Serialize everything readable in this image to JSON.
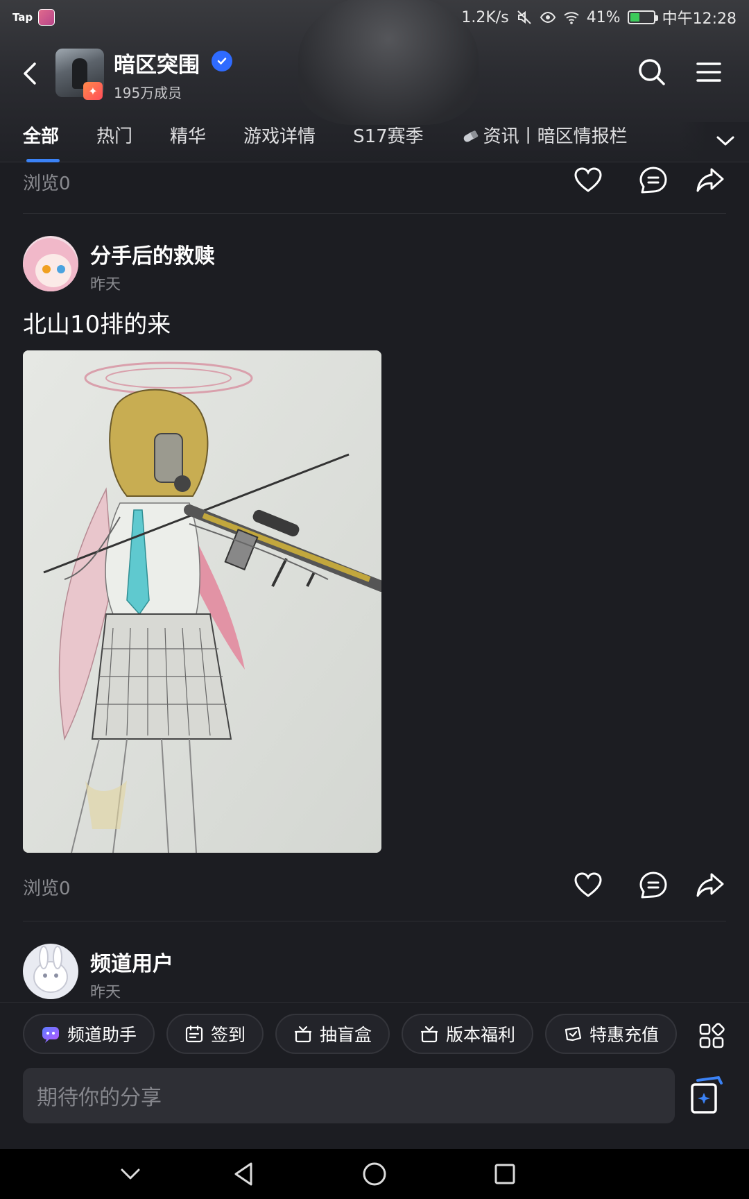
{
  "status_bar": {
    "brand": "Tap",
    "net_speed": "1.2K/s",
    "battery_percent": "41%",
    "battery_level": 0.41,
    "time": "中午12:28"
  },
  "channel": {
    "name": "暗区突围",
    "members": "195万成员",
    "verified": true
  },
  "tabs": [
    {
      "label": "全部",
      "active": true
    },
    {
      "label": "热门"
    },
    {
      "label": "精华"
    },
    {
      "label": "游戏详情"
    },
    {
      "label": "S17赛季"
    },
    {
      "label": "资讯丨暗区情报栏",
      "icon": "bullet-icon"
    }
  ],
  "feed": {
    "prev_post": {
      "views": "浏览0"
    },
    "post": {
      "author": "分手后的救赎",
      "time": "昨天",
      "text": "北山10排的来",
      "views": "浏览0"
    },
    "next_post": {
      "author": "频道用户",
      "time": "昨天"
    }
  },
  "quick_actions": [
    {
      "label": "频道助手",
      "icon": "assistant-icon"
    },
    {
      "label": "签到",
      "icon": "calendar-icon"
    },
    {
      "label": "抽盲盒",
      "icon": "gift-box-icon"
    },
    {
      "label": "版本福利",
      "icon": "gift-icon"
    },
    {
      "label": "特惠充值",
      "icon": "gamepad-icon"
    }
  ],
  "composer": {
    "placeholder": "期待你的分享"
  },
  "colors": {
    "background": "#1c1d22",
    "accent": "#3b82f6",
    "muted_text": "#8a8b90"
  }
}
